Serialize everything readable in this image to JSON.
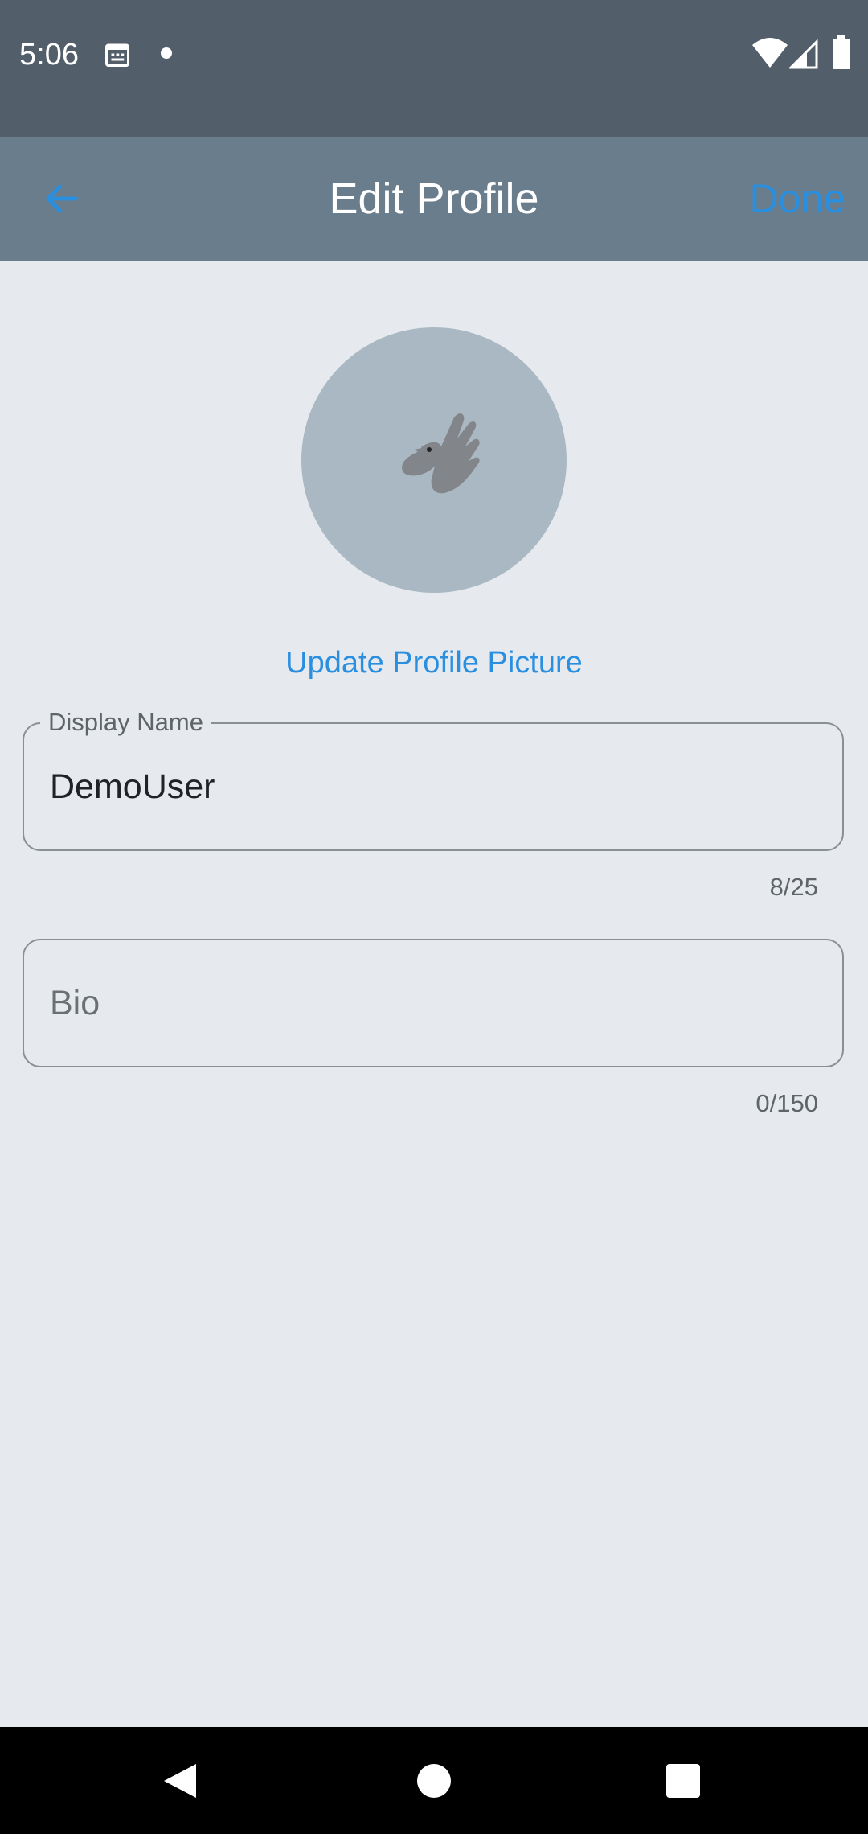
{
  "status_bar": {
    "time": "5:06",
    "icons": [
      "calendar-icon",
      "notification-dot-icon",
      "wifi-icon",
      "cell-signal-icon",
      "battery-icon"
    ]
  },
  "app_bar": {
    "back_icon": "arrow-left-icon",
    "title": "Edit Profile",
    "done_label": "Done",
    "accent_color": "#2b8fe0",
    "background_color": "#6a7d8d"
  },
  "profile": {
    "avatar_icon": "bird-hand-icon",
    "update_picture_label": "Update Profile Picture"
  },
  "form": {
    "display_name": {
      "label": "Display Name",
      "value": "DemoUser",
      "counter": "8/25"
    },
    "bio": {
      "placeholder": "Bio",
      "value": "",
      "counter": "0/150"
    }
  },
  "nav_bar": {
    "icons": [
      "back-triangle-icon",
      "home-circle-icon",
      "recents-square-icon"
    ]
  }
}
